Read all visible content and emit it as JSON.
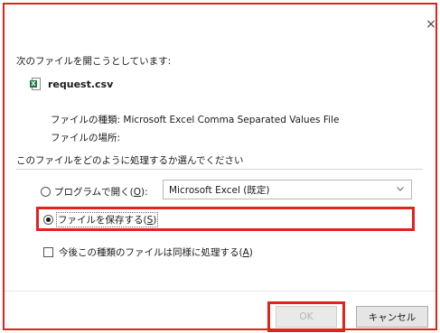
{
  "dialog": {
    "close_symbol": "×",
    "prompt": "次のファイルを開こうとしています:",
    "file": {
      "icon": "excel-csv-icon",
      "name": "request.csv"
    },
    "file_type_label": "ファイルの種類:",
    "file_type_value": "Microsoft Excel Comma Separated Values File",
    "file_location_label": "ファイルの場所:",
    "group_title": "このファイルをどのように処理するか選んでください",
    "open_with": {
      "label": "プログラムで開く(",
      "key": "O",
      "suffix": "):",
      "selected": false,
      "program": "Microsoft Excel (既定)"
    },
    "save_file": {
      "label": "ファイルを保存する(",
      "key": "S",
      "suffix": ")",
      "selected": true
    },
    "remember": {
      "label": "今後この種類のファイルは同様に処理する(",
      "key": "A",
      "suffix": ")",
      "checked": false
    },
    "buttons": {
      "ok": "OK",
      "cancel": "キャンセル"
    }
  },
  "colors": {
    "highlight": "#e1241b",
    "excel_green": "#1d7a3f"
  }
}
